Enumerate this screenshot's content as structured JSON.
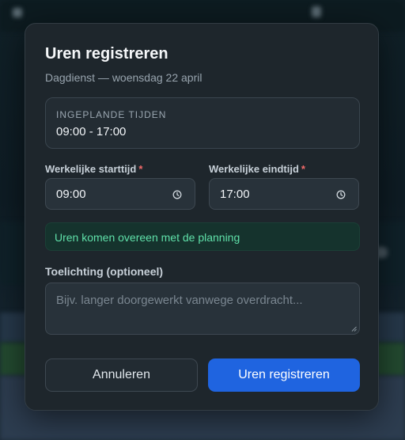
{
  "dialog": {
    "title": "Uren registreren",
    "subtitle": "Dagdienst — woensdag 22 april",
    "planned": {
      "label": "INGEPLANDE TIJDEN",
      "value": "09:00 - 17:00"
    },
    "start": {
      "label": "Werkelijke starttijd",
      "required_mark": "*",
      "value": "09:00",
      "icon": "clock-icon"
    },
    "end": {
      "label": "Werkelijke eindtijd",
      "required_mark": "*",
      "value": "17:00",
      "icon": "clock-icon"
    },
    "status": {
      "text": "Uren komen overeen met de planning",
      "color": "#5fe0a9"
    },
    "note": {
      "label": "Toelichting (optioneel)",
      "placeholder": "Bijv. langer doorgewerkt vanwege overdracht..."
    },
    "buttons": {
      "cancel": "Annuleren",
      "submit": "Uren registreren"
    }
  },
  "colors": {
    "primary": "#1f64e0",
    "required": "#f26a6a",
    "success": "#5fe0a9"
  }
}
